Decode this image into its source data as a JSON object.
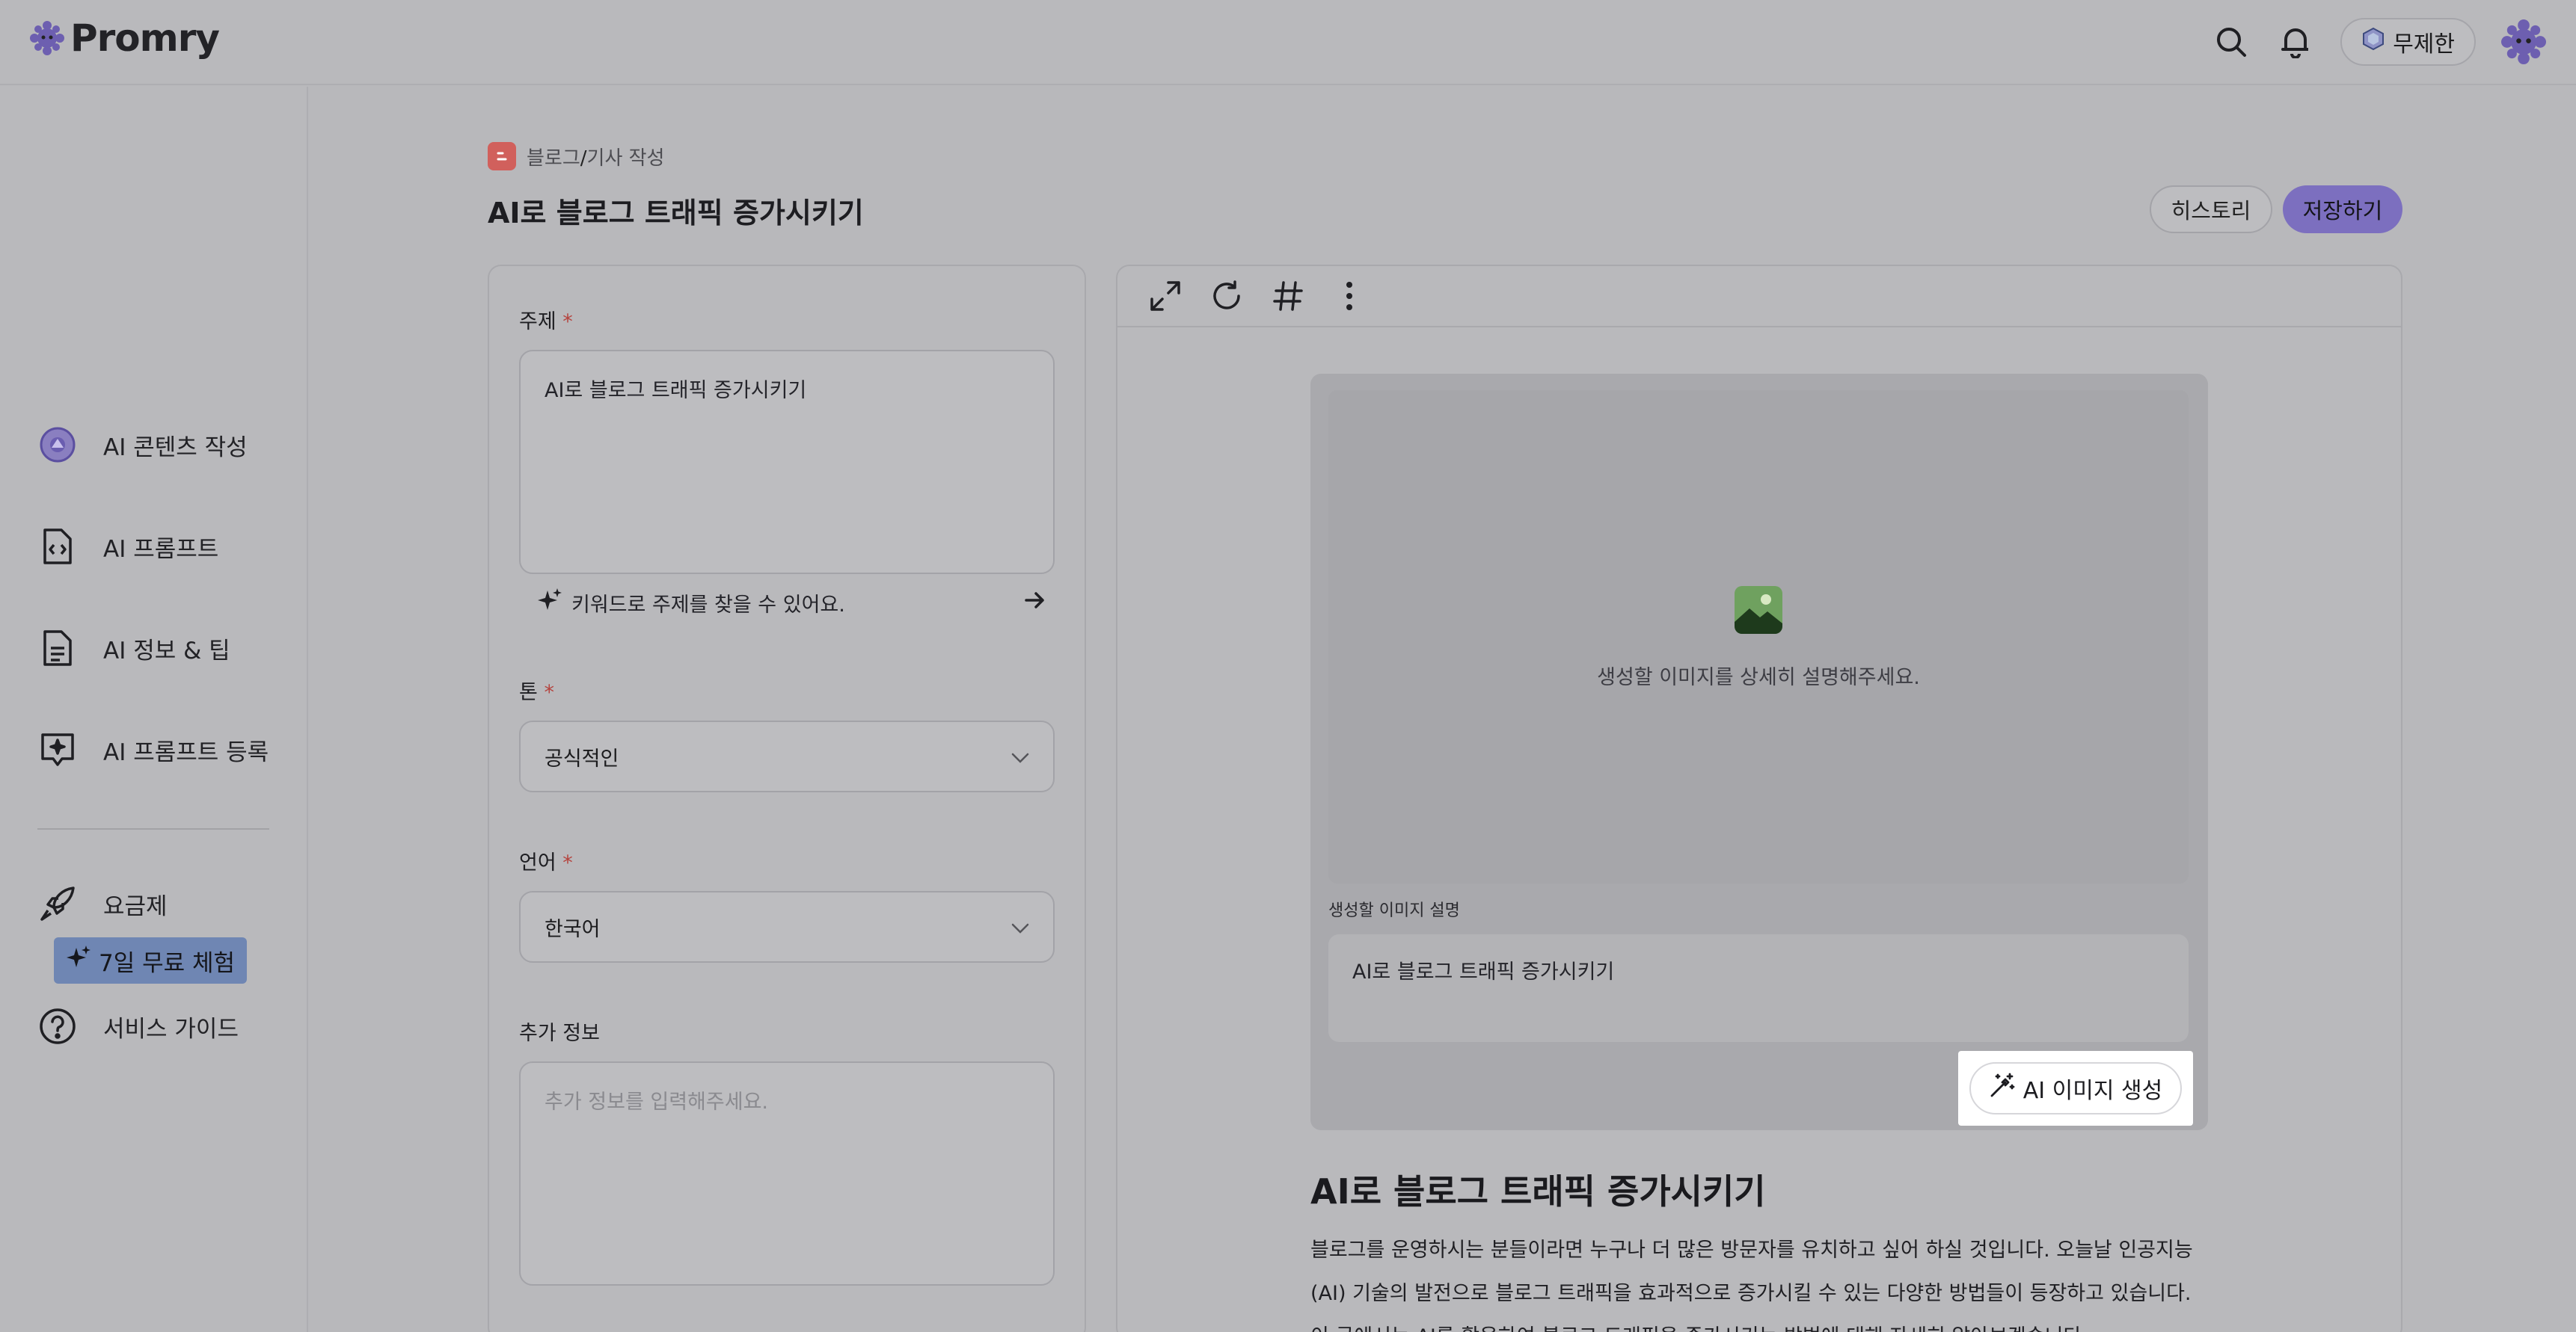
{
  "header": {
    "logo_text": "Promry",
    "plan_label": "무제한",
    "icons": [
      "search-icon",
      "bell-icon",
      "plan-icon",
      "avatar-icon"
    ]
  },
  "sidebar": {
    "items": [
      {
        "label": "AI 콘텐츠 작성",
        "icon": "ai-content-icon"
      },
      {
        "label": "AI 프롬프트",
        "icon": "code-file-icon"
      },
      {
        "label": "AI 정보 & 팁",
        "icon": "document-icon"
      },
      {
        "label": "AI 프롬프트 등록",
        "icon": "sparkle-chat-icon"
      },
      {
        "label": "요금제",
        "icon": "rocket-icon"
      },
      {
        "label": "서비스 가이드",
        "icon": "help-icon"
      }
    ],
    "trial_badge": "7일 무료 체험"
  },
  "main": {
    "breadcrumb": {
      "section": "블로그",
      "separator": "/",
      "page": "기사 작성"
    },
    "title": "AI로 블로그 트래픽 증가시키기",
    "history_button": "히스토리",
    "save_button": "저장하기"
  },
  "form": {
    "topic_label": "주제",
    "topic_value": "AI로 블로그 트래픽 증가시키기",
    "required_mark": "*",
    "keyword_hint": "키워드로 주제를 찾을 수 있어요.",
    "tone_label": "톤",
    "tone_value": "공식적인",
    "language_label": "언어",
    "language_value": "한국어",
    "extra_label": "추가 정보",
    "extra_placeholder": "추가 정보를 입력해주세요."
  },
  "editor": {
    "tools": [
      "expand-icon",
      "refresh-icon",
      "hashtag-icon",
      "more-icon"
    ],
    "image_prompt_hint": "생성할 이미지를 상세히 설명해주세요.",
    "image_desc_label": "생성할 이미지 설명",
    "image_desc_value": "AI로 블로그 트래픽 증가시키기",
    "generate_button": "AI 이미지 생성",
    "article_title": "AI로 블로그 트래픽 증가시키기",
    "article_body": "블로그를 운영하시는 분들이라면 누구나 더 많은 방문자를 유치하고 싶어 하실 것입니다. 오늘날 인공지능(AI) 기술의 발전으로 블로그 트래픽을 효과적으로 증가시킬 수 있는 다양한 방법들이 등장하고 있습니다. 이 글에서는 AI를 활용하여 블로그 트래픽을 증가시키는 방법에 대해 자세히 알아보겠습니다."
  },
  "colors": {
    "accent": "#7c6fbf",
    "required": "#b5433e",
    "trial_badge": "#6f86b3",
    "blog_icon": "#d1605c"
  }
}
